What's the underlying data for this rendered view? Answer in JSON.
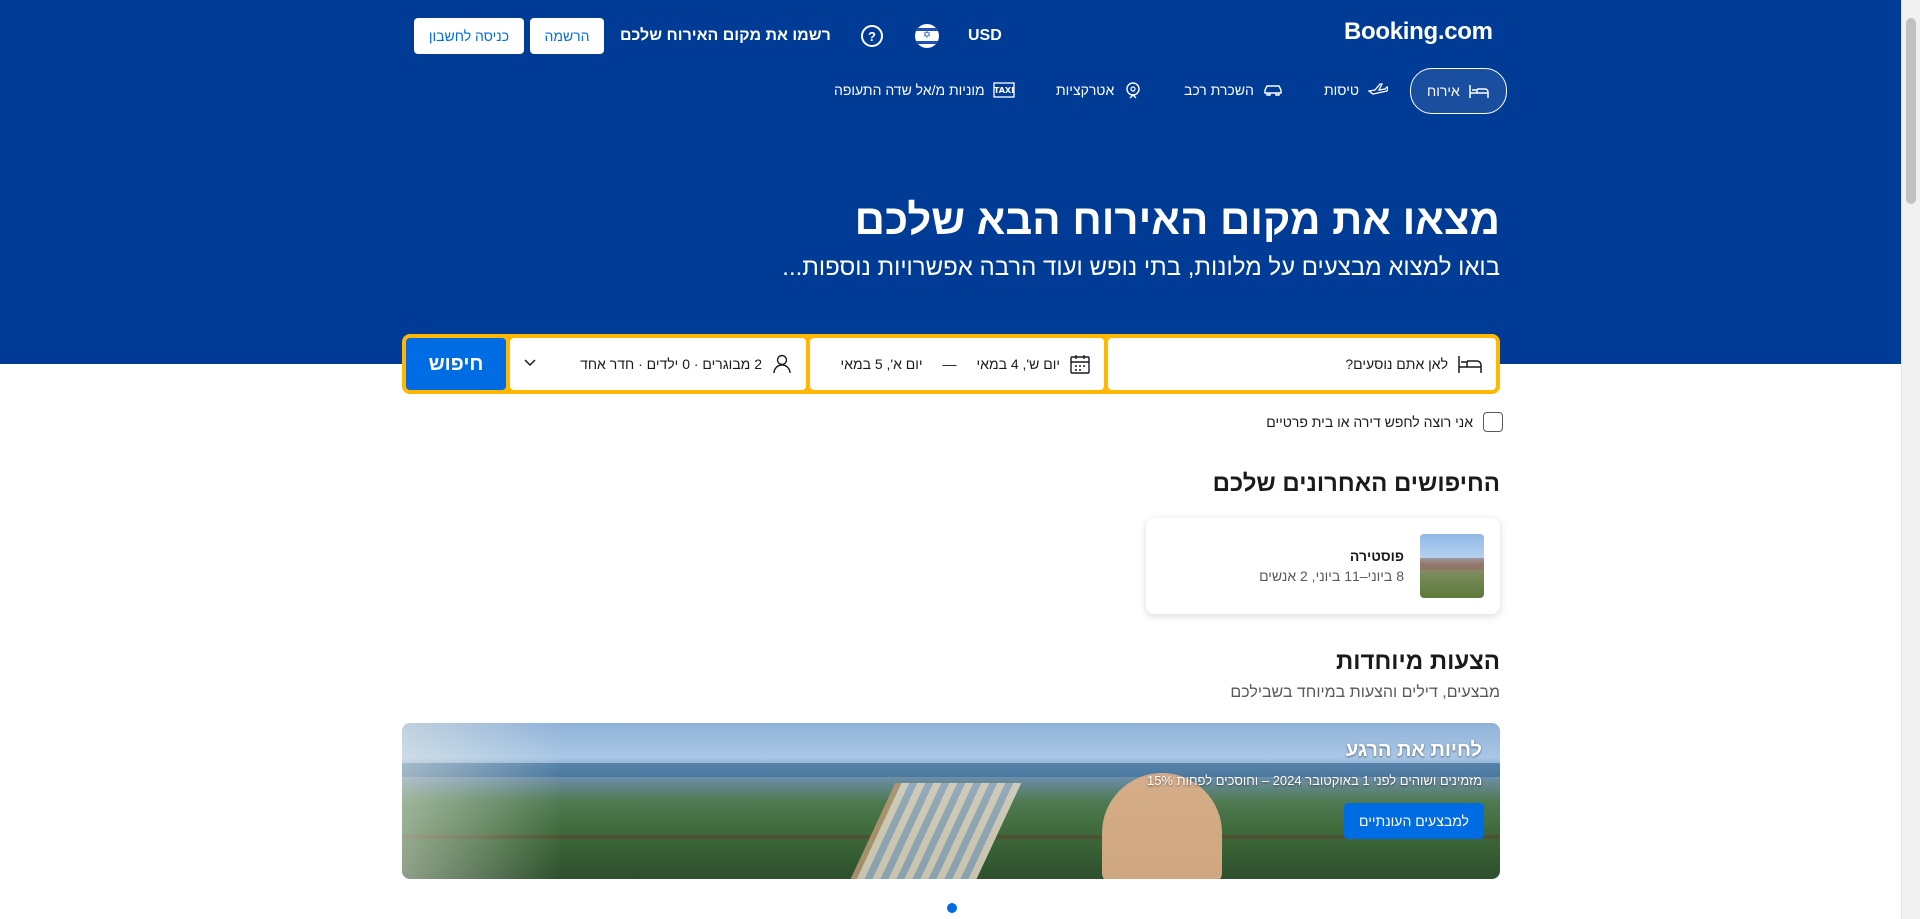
{
  "header": {
    "logo": "Booking.com",
    "currency": "USD",
    "list_property": "רשמו את מקום האירוח שלכם",
    "register": "הרשמה",
    "sign_in": "כניסה לחשבון"
  },
  "nav": {
    "items": [
      {
        "label": "אירוח",
        "icon": "bed-icon",
        "active": true
      },
      {
        "label": "טיסות",
        "icon": "plane-icon"
      },
      {
        "label": "השכרת רכב",
        "icon": "car-icon"
      },
      {
        "label": "אטרקציות",
        "icon": "attractions-icon"
      },
      {
        "label": "מוניות מ/אל שדה התעופה",
        "icon": "taxi-icon"
      }
    ]
  },
  "hero": {
    "title": "מצאו את מקום האירוח הבא שלכם",
    "subtitle": "בואו למצוא מבצעים על מלונות, בתי נופש ועוד הרבה אפשרויות נוספות..."
  },
  "search": {
    "destination_placeholder": "לאן אתם נוסעים?",
    "check_in": "יום ש', 4 במאי",
    "dash": "—",
    "check_out": "יום א', 5 במאי",
    "guests": "2 מבוגרים · 0 ילדים · חדר אחד",
    "button": "חיפוש",
    "checkbox_label": "אני רוצה לחפש דירה או בית פרטיים"
  },
  "recent": {
    "title": "החיפושים האחרונים שלכם",
    "items": [
      {
        "name": "פוסטירה",
        "details": "8 ביוני–11 ביוני, 2 אנשים"
      }
    ]
  },
  "offers": {
    "title": "הצעות מיוחדות",
    "subtitle": "מבצעים, דילים והצעות במיוחד בשבילכם",
    "banner_title": "לחיות את הרגע",
    "banner_subtitle": "מזמינים ושוהים לפני 1 באוקטובר 2024 – וחוסכים לפחות 15%",
    "banner_button": "למבצעים העונתיים"
  },
  "colors": {
    "brand_blue": "#003b95",
    "accent_blue": "#006ce4",
    "search_border": "#ffb700"
  }
}
